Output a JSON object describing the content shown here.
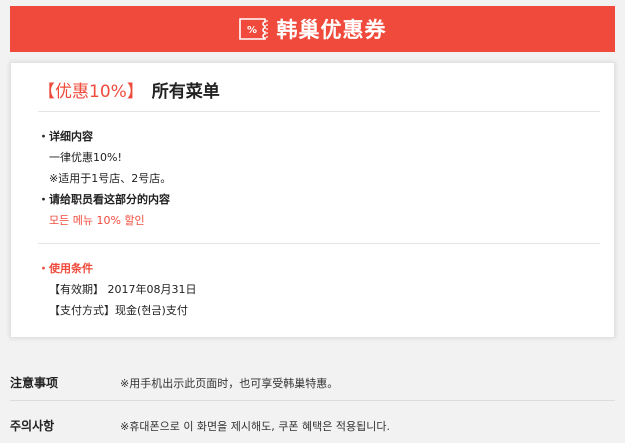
{
  "header": {
    "title": "韩巢优惠券",
    "icon": "coupon-ticket-icon",
    "icon_glyph": "%",
    "bg_color": "#f04a3c"
  },
  "coupon": {
    "tag": "【优惠10%】",
    "menu": "所有菜单",
    "details_label": "・详细内容",
    "detail_lines": [
      "一律优惠10%!",
      "※适用于1号店、2号店。"
    ],
    "staff_label": "・请给职员看这部分的内容",
    "staff_text": "모든 메뉴 10% 할인",
    "conditions_label": "・使用条件",
    "validity": "【有效期】 2017年08月31日",
    "payment": "【支付方式】现金(현금)支付"
  },
  "notes": [
    {
      "label": "注意事项",
      "text": "※用手机出示此页面时，也可享受韩巢特惠。"
    },
    {
      "label": "주의사항",
      "text": "※휴대폰으로 이 화면을 제시해도, 쿠폰 혜택은 적용됩니다."
    }
  ],
  "colors": {
    "accent": "#ef4b3c",
    "background": "#f2f2f2"
  }
}
